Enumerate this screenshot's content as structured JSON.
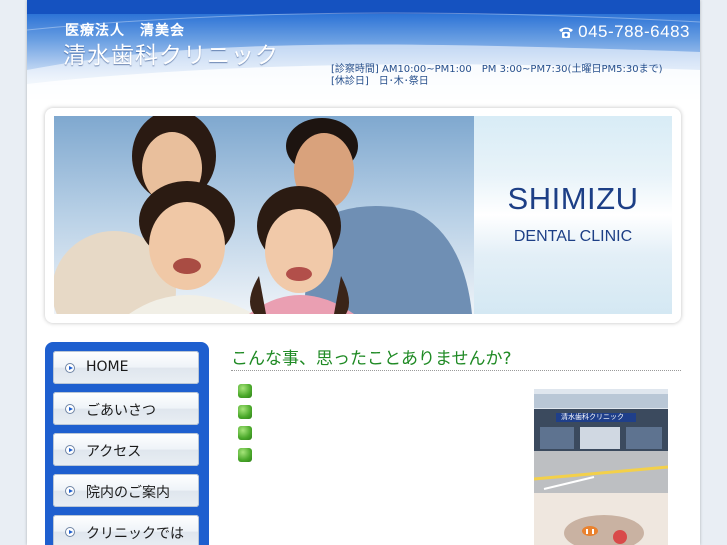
{
  "header": {
    "org_name": "医療法人　清美会",
    "clinic_name": "清水歯科クリニック",
    "phone": "045-788-6483",
    "phone_icon": "phone-icon",
    "hours_line1": "[診察時間] AM10:00~PM1:00　PM 3:00~PM7:30(土曜日PM5:30まで)",
    "hours_line2": "[休診日]　日･木･祭日"
  },
  "hero": {
    "brand_line1": "SHIMIZU",
    "brand_line2": "DENTAL CLINIC"
  },
  "sidebar": {
    "items": [
      {
        "label": "HOME"
      },
      {
        "label": "ごあいさつ"
      },
      {
        "label": "アクセス"
      },
      {
        "label": "院内のご案内"
      },
      {
        "label": "クリニックでは"
      }
    ]
  },
  "main": {
    "title": "こんな事、思ったことありませんか?",
    "bullet_count": 4
  },
  "photos": {
    "building_sign": "清水歯科クリニック"
  },
  "colors": {
    "header_blue": "#1552c0",
    "sidebar_blue": "#1e5fcf",
    "title_green": "#1f8a24",
    "brand_navy": "#1d3f86"
  }
}
